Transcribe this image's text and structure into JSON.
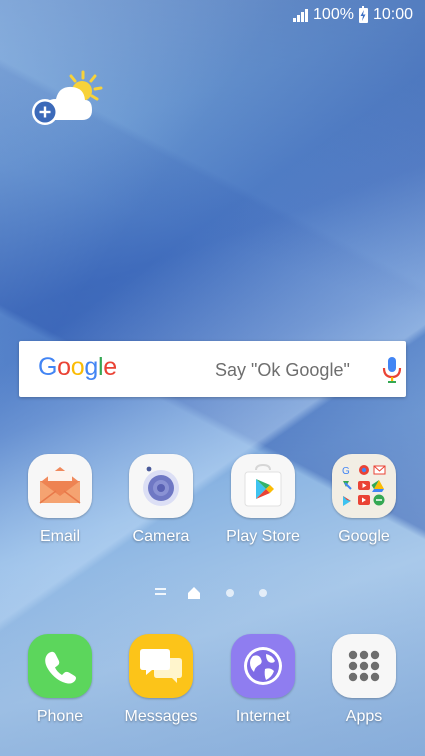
{
  "status_bar": {
    "battery_percent": "100%",
    "time": "10:00"
  },
  "weather_widget": {
    "icon": "weather-partly-sunny-add-icon"
  },
  "search_bar": {
    "logo": "Google",
    "hint": "Say \"Ok Google\"",
    "icon": "microphone-icon"
  },
  "apps": [
    {
      "label": "Email",
      "icon": "email-icon"
    },
    {
      "label": "Camera",
      "icon": "camera-icon"
    },
    {
      "label": "Play Store",
      "icon": "play-store-icon"
    },
    {
      "label": "Google",
      "icon": "google-folder-icon"
    }
  ],
  "page_indicator": {
    "pages": 3,
    "current": "home"
  },
  "dock": [
    {
      "label": "Phone",
      "icon": "phone-icon"
    },
    {
      "label": "Messages",
      "icon": "messages-icon"
    },
    {
      "label": "Internet",
      "icon": "internet-icon"
    },
    {
      "label": "Apps",
      "icon": "apps-grid-icon"
    }
  ],
  "colors": {
    "google_blue": "#4285F4",
    "google_red": "#EA4335",
    "google_yellow": "#FBBC05",
    "google_green": "#34A853"
  }
}
